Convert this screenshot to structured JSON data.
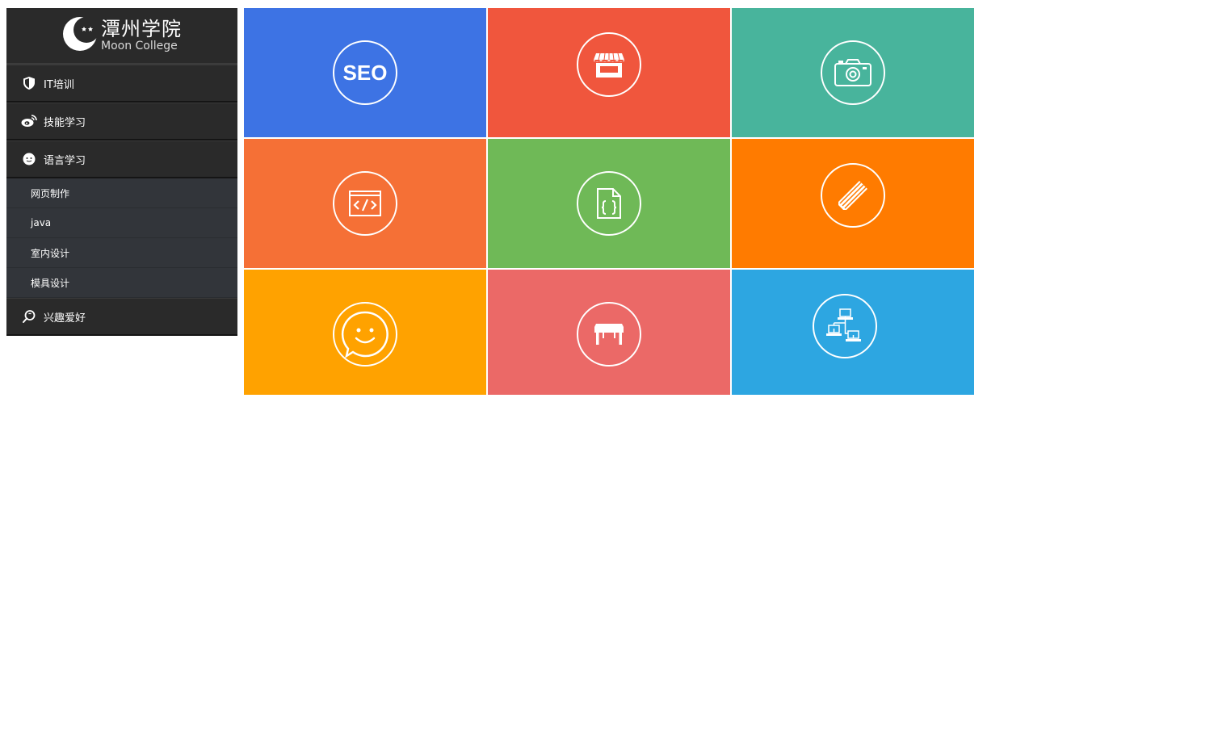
{
  "brand": {
    "name_cn": "潭州学院",
    "name_en": "Moon College"
  },
  "menu": [
    {
      "label": "IT培训",
      "icon": "shield-icon"
    },
    {
      "label": "技能学习",
      "icon": "weibo-icon"
    },
    {
      "label": "语言学习",
      "icon": "chat-bubble-icon"
    },
    {
      "label": "兴趣爱好",
      "icon": "search-hand-icon"
    }
  ],
  "submenu": [
    "网页制作",
    "java",
    "室内设计",
    "模具设计"
  ],
  "tiles": [
    {
      "name": "seo",
      "color": "#3d73e4",
      "icon_text": "SEO"
    },
    {
      "name": "shop",
      "color": "#f0563d"
    },
    {
      "name": "camera",
      "color": "#48b49c"
    },
    {
      "name": "code",
      "color": "#f57036"
    },
    {
      "name": "json-file",
      "color": "#6fb957"
    },
    {
      "name": "pencil",
      "color": "#ff7b00"
    },
    {
      "name": "smiley",
      "color": "#ffa200"
    },
    {
      "name": "table",
      "color": "#eb6967"
    },
    {
      "name": "network",
      "color": "#2da6e1"
    }
  ]
}
